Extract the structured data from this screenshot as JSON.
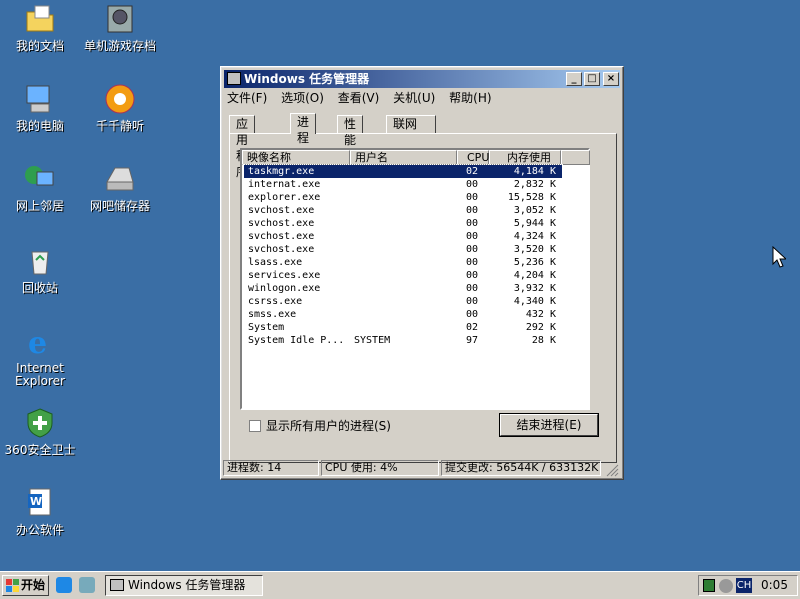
{
  "desktop": {
    "icons": [
      {
        "label": "我的文档"
      },
      {
        "label": "单机游戏存档"
      },
      {
        "label": "我的电脑"
      },
      {
        "label": "千千静听"
      },
      {
        "label": "网上邻居"
      },
      {
        "label": "网吧储存器"
      },
      {
        "label": "回收站"
      },
      {
        "label": "Internet Explorer"
      },
      {
        "label": "360安全卫士"
      },
      {
        "label": "办公软件"
      }
    ]
  },
  "window": {
    "title": "Windows 任务管理器",
    "minimize": "_",
    "maximize": "□",
    "close": "×",
    "menu": [
      "文件(F)",
      "选项(O)",
      "查看(V)",
      "关机(U)",
      "帮助(H)"
    ],
    "tabs": [
      "应用程序",
      "进程",
      "性能",
      "联网"
    ],
    "columns": {
      "name": "映像名称",
      "user": "用户名",
      "cpu": "CPU",
      "mem": "内存使用"
    },
    "processes": [
      {
        "name": "taskmgr.exe",
        "user": "",
        "cpu": "02",
        "mem": "4,184 K"
      },
      {
        "name": "internat.exe",
        "user": "",
        "cpu": "00",
        "mem": "2,832 K"
      },
      {
        "name": "explorer.exe",
        "user": "",
        "cpu": "00",
        "mem": "15,528 K"
      },
      {
        "name": "svchost.exe",
        "user": "",
        "cpu": "00",
        "mem": "3,052 K"
      },
      {
        "name": "svchost.exe",
        "user": "",
        "cpu": "00",
        "mem": "5,944 K"
      },
      {
        "name": "svchost.exe",
        "user": "",
        "cpu": "00",
        "mem": "4,324 K"
      },
      {
        "name": "svchost.exe",
        "user": "",
        "cpu": "00",
        "mem": "3,520 K"
      },
      {
        "name": "lsass.exe",
        "user": "",
        "cpu": "00",
        "mem": "5,236 K"
      },
      {
        "name": "services.exe",
        "user": "",
        "cpu": "00",
        "mem": "4,204 K"
      },
      {
        "name": "winlogon.exe",
        "user": "",
        "cpu": "00",
        "mem": "3,932 K"
      },
      {
        "name": "csrss.exe",
        "user": "",
        "cpu": "00",
        "mem": "4,340 K"
      },
      {
        "name": "smss.exe",
        "user": "",
        "cpu": "00",
        "mem": "432 K"
      },
      {
        "name": "System",
        "user": "",
        "cpu": "02",
        "mem": "292 K"
      },
      {
        "name": "System Idle P...",
        "user": "SYSTEM",
        "cpu": "97",
        "mem": "28 K"
      }
    ],
    "show_all_users": "显示所有用户的进程(S)",
    "end_process": "结束进程(E)",
    "status": {
      "processes": "进程数: 14",
      "cpu": "CPU 使用: 4%",
      "commit": "提交更改: 56544K / 633132K"
    }
  },
  "taskbar": {
    "start": "开始",
    "task_item": "Windows 任务管理器",
    "ime": "CH",
    "clock": "0:05"
  }
}
